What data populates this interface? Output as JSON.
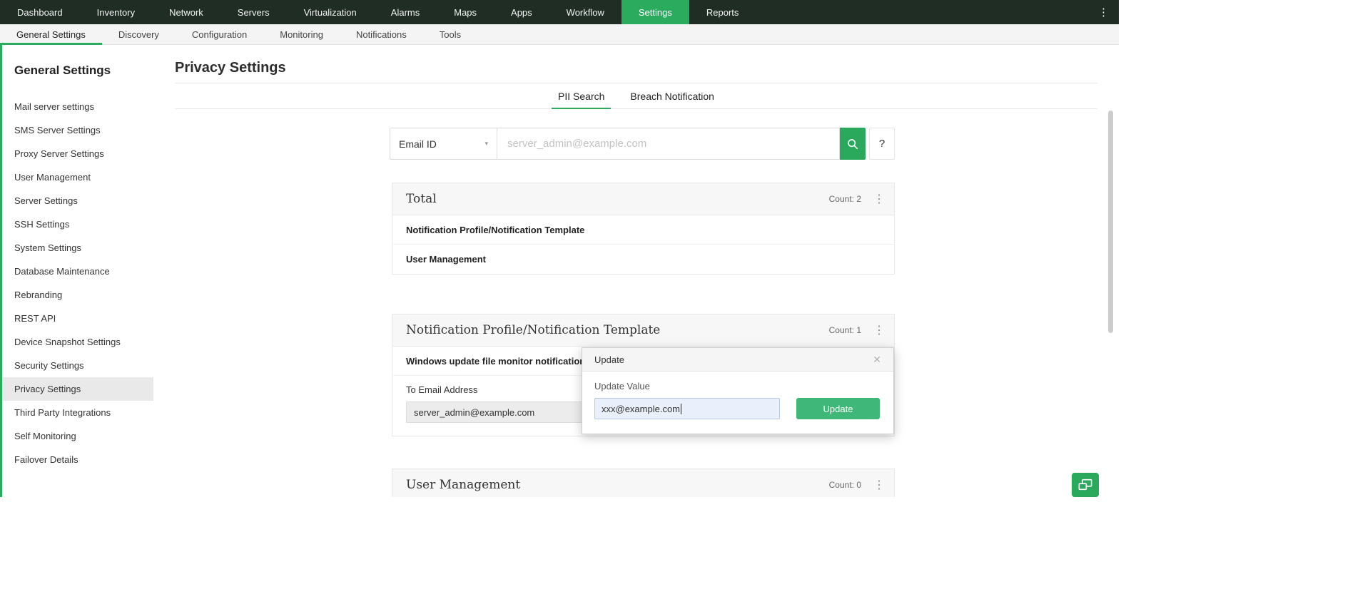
{
  "colors": {
    "nav_bg": "#1f2d24",
    "accent_green": "#2aab5e",
    "button_green": "#3eb778",
    "panel_header_bg": "#f7f7f7"
  },
  "icons": {
    "kebab": "⋮",
    "overflow": "⋮",
    "close": "✕",
    "chevron_down": "▾",
    "help": "?"
  },
  "top_nav": {
    "items": [
      "Dashboard",
      "Inventory",
      "Network",
      "Servers",
      "Virtualization",
      "Alarms",
      "Maps",
      "Apps",
      "Workflow",
      "Settings",
      "Reports"
    ],
    "active_item": "Settings"
  },
  "tab_bar": {
    "items": [
      "General Settings",
      "Discovery",
      "Configuration",
      "Monitoring",
      "Notifications",
      "Tools"
    ],
    "active_item": "General Settings"
  },
  "sidebar": {
    "title": "General Settings",
    "items": [
      "Mail server settings",
      "SMS Server Settings",
      "Proxy Server Settings",
      "User Management",
      "Server Settings",
      "SSH Settings",
      "System Settings",
      "Database Maintenance",
      "Rebranding",
      "REST API",
      "Device Snapshot Settings",
      "Security Settings",
      "Privacy Settings",
      "Third Party Integrations",
      "Self Monitoring",
      "Failover Details"
    ],
    "active_item": "Privacy Settings"
  },
  "main": {
    "title": "Privacy Settings",
    "tabs": {
      "pii": "PII Search",
      "breach": "Breach Notification",
      "active": "PII Search"
    },
    "search": {
      "filter_value": "Email ID",
      "input_placeholder": "server_admin@example.com",
      "help_label": "?"
    },
    "panel_total": {
      "title": "Total",
      "count": "Count: 2",
      "rows": [
        "Notification Profile/Notification Template",
        "User Management"
      ]
    },
    "panel_notification": {
      "title": "Notification Profile/Notification Template",
      "count": "Count: 1",
      "row": "Windows update file monitor notification",
      "field_label": "To Email Address",
      "field_value": "server_admin@example.com"
    },
    "panel_user": {
      "title": "User Management",
      "count": "Count: 0"
    }
  },
  "popup": {
    "title": "Update",
    "field_label": "Update Value",
    "field_value": "xxx@example.com",
    "button_label": "Update"
  }
}
